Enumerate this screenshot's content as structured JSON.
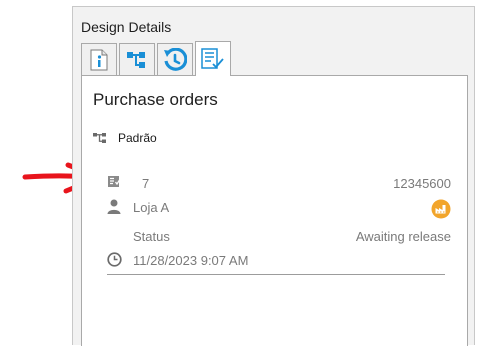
{
  "panel": {
    "title": "Design Details"
  },
  "tabs": [
    {
      "icon": "info-icon",
      "active": false
    },
    {
      "icon": "hierarchy-icon",
      "active": false
    },
    {
      "icon": "history-icon",
      "active": false
    },
    {
      "icon": "checklist-icon",
      "active": true
    }
  ],
  "section": {
    "title": "Purchase orders"
  },
  "design": {
    "label": "Padrão",
    "icon": "hierarchy-icon"
  },
  "order": {
    "number": "7",
    "code": "12345600",
    "customer": "Loja A",
    "status_label": "Status",
    "status_value": "Awaiting release",
    "datetime": "11/28/2023 9:07 AM"
  },
  "colors": {
    "accent": "#1a8fd6",
    "arrow": "#e8141c",
    "factory_badge": "#f2a52b"
  },
  "annotation": {
    "icon": "red-arrow-icon"
  }
}
